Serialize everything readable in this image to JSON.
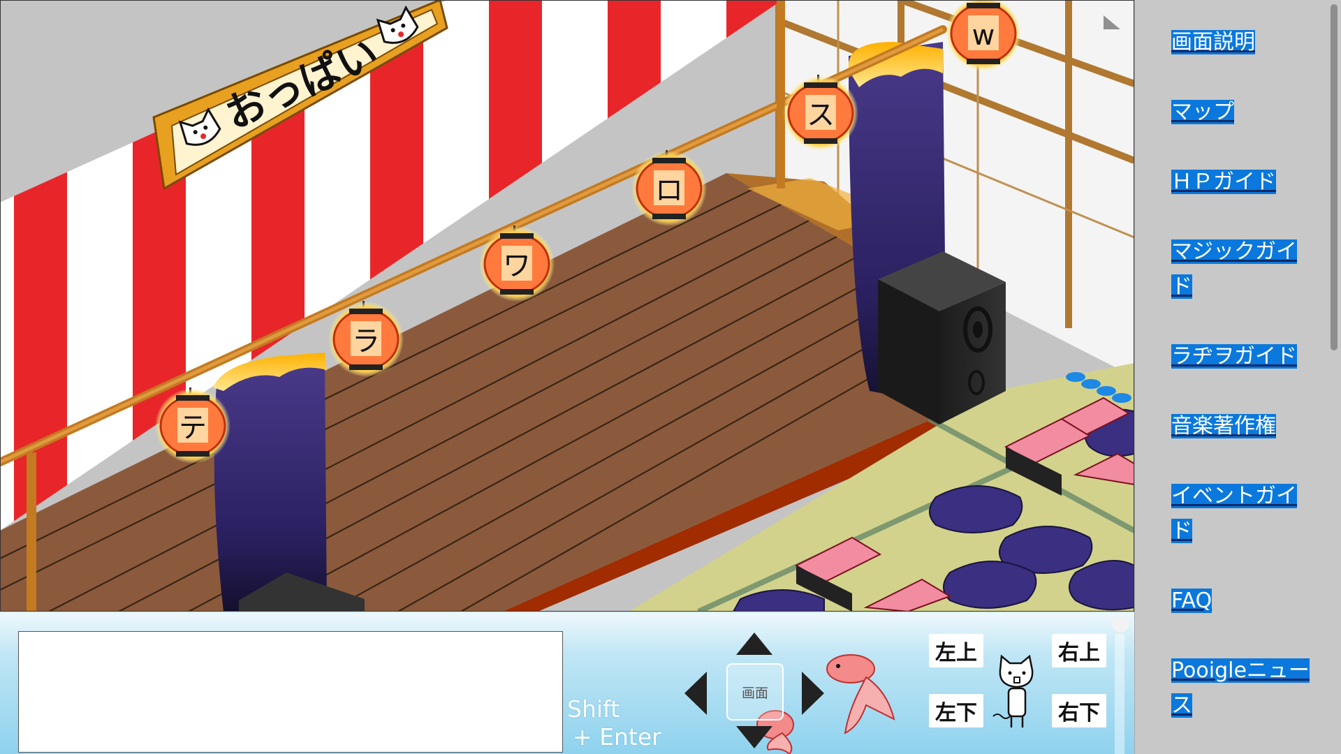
{
  "scene": {
    "banner_text": "おっぱい",
    "lanterns": [
      "テ",
      "ラ",
      "ワ",
      "ロ",
      "ス",
      "w"
    ]
  },
  "sidebar": {
    "links": [
      {
        "label": "画面説明"
      },
      {
        "label": "マップ"
      },
      {
        "label": "ＨＰガイド"
      },
      {
        "label": "マジックガイド"
      },
      {
        "label": "ラヂヲガイド"
      },
      {
        "label": "音楽著作権"
      },
      {
        "label": "イベントガイド"
      },
      {
        "label": "FAQ"
      },
      {
        "label": "Pooigleニュース"
      }
    ]
  },
  "panel": {
    "chat_value": "",
    "shift_line1": "Shift",
    "shift_line2": "+ Enter",
    "screen_button": "画面",
    "directions": {
      "up_left": "左上",
      "up_right": "右上",
      "down_left": "左下",
      "down_right": "右下"
    }
  },
  "colors": {
    "sidebar_link_bg": "#0a78dc",
    "curtain_red": "#e8262a",
    "stage_wood": "#8b5a3c",
    "panel_blue": "#8fd2ee"
  }
}
